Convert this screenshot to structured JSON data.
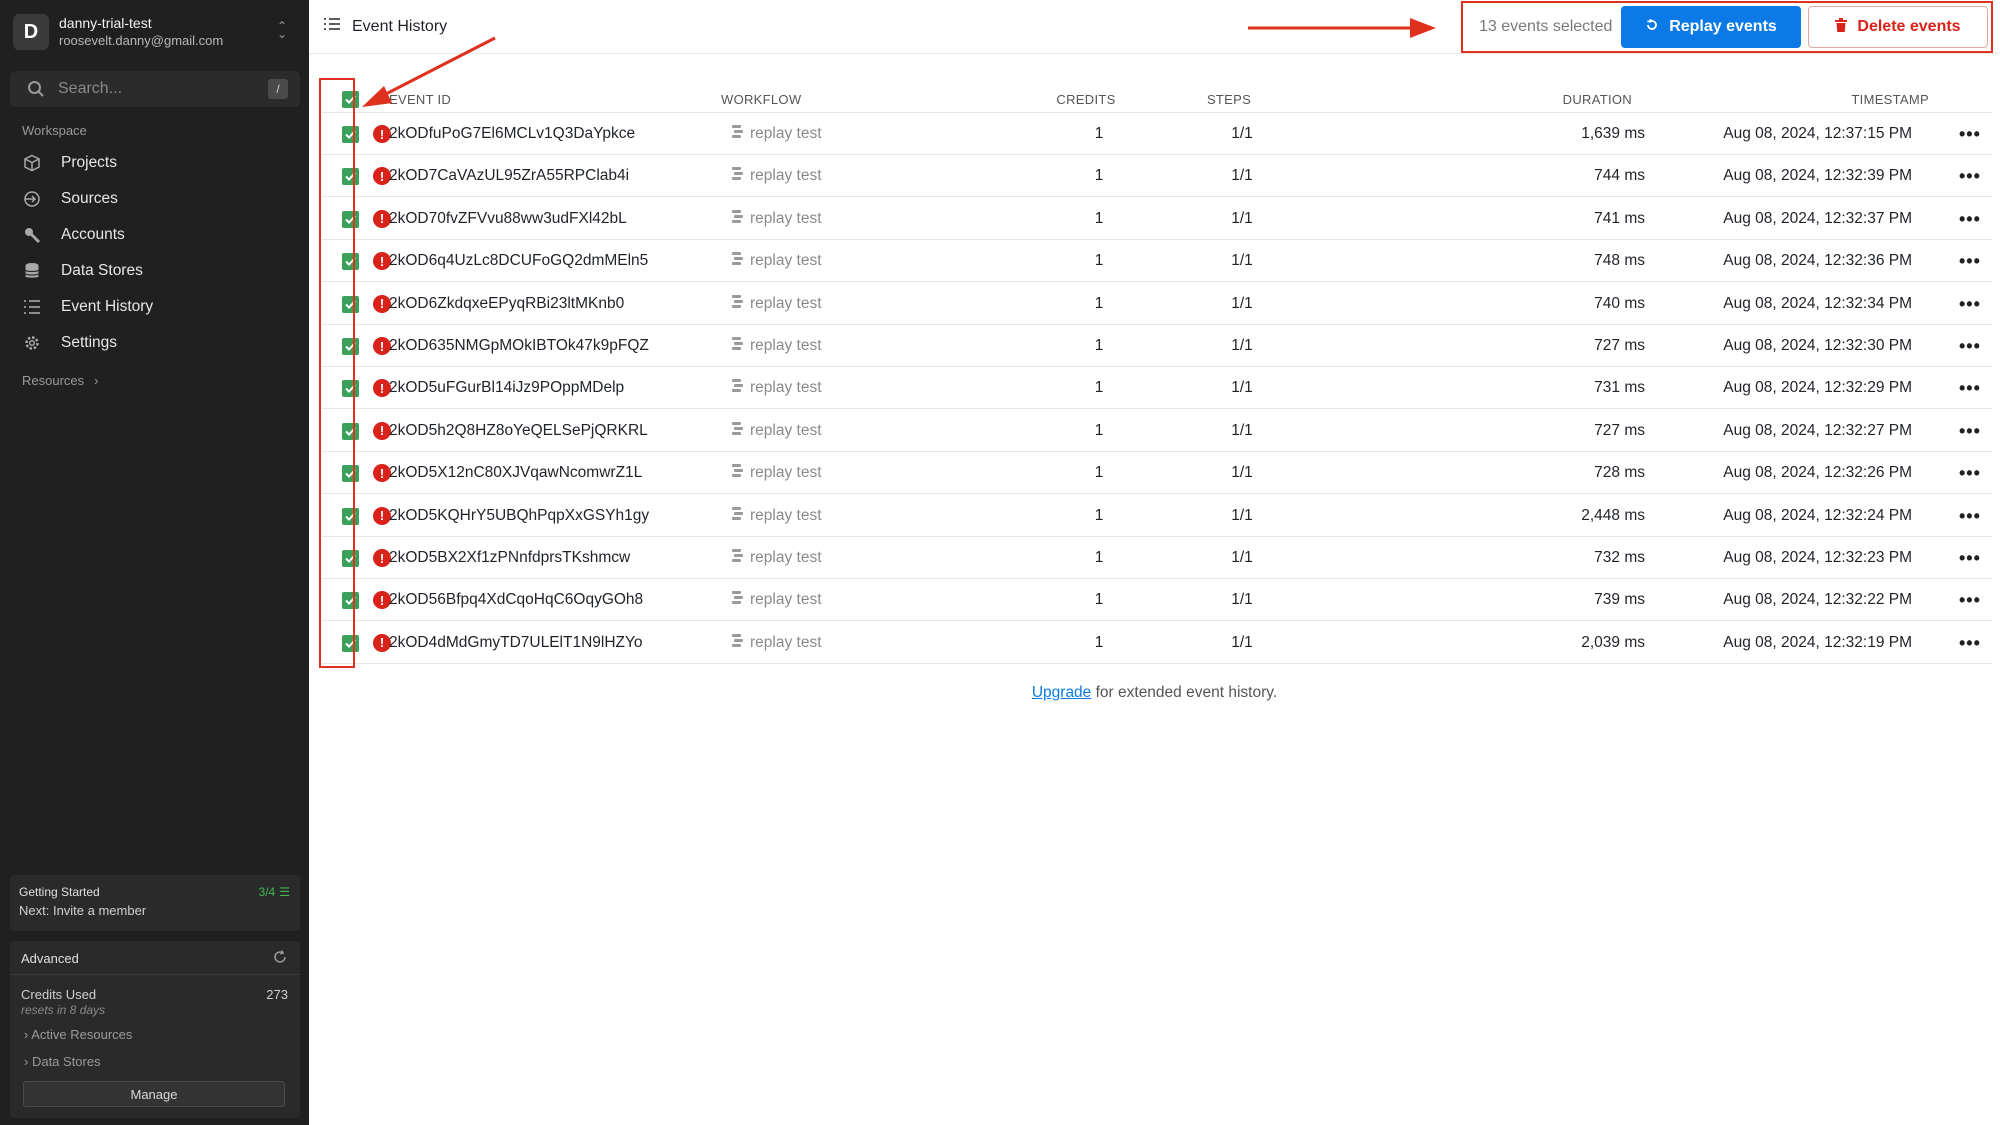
{
  "account": {
    "initial": "D",
    "name": "danny-trial-test",
    "email": "roosevelt.danny@gmail.com"
  },
  "search": {
    "placeholder": "Search...",
    "shortcut": "/"
  },
  "sidebar": {
    "section_label": "Workspace",
    "items": [
      {
        "label": "Projects",
        "icon": "cube-icon"
      },
      {
        "label": "Sources",
        "icon": "source-icon"
      },
      {
        "label": "Accounts",
        "icon": "wrench-icon"
      },
      {
        "label": "Data Stores",
        "icon": "database-icon"
      },
      {
        "label": "Event History",
        "icon": "list-icon"
      },
      {
        "label": "Settings",
        "icon": "gear-icon"
      }
    ],
    "resources_label": "Resources"
  },
  "getting_started": {
    "title": "Getting Started",
    "progress": "3/4",
    "next": "Next: Invite a member"
  },
  "advanced": {
    "title": "Advanced",
    "credits_label": "Credits Used",
    "credits_value": "273",
    "credits_reset": "resets in 8 days",
    "active_resources": "Active Resources",
    "data_stores": "Data Stores",
    "manage_label": "Manage"
  },
  "header": {
    "title": "Event History",
    "selected_text": "13 events selected",
    "replay_label": "Replay events",
    "delete_label": "Delete events"
  },
  "table": {
    "columns": [
      "EVENT ID",
      "WORKFLOW",
      "CREDITS",
      "STEPS",
      "DURATION",
      "TIMESTAMP"
    ],
    "rows": [
      {
        "id": "2kODfuPoG7El6MCLv1Q3DaYpkce",
        "workflow": "replay test",
        "credits": "1",
        "steps": "1/1",
        "duration": "1,639 ms",
        "timestamp": "Aug 08, 2024, 12:37:15 PM"
      },
      {
        "id": "2kOD7CaVAzUL95ZrA55RPClab4i",
        "workflow": "replay test",
        "credits": "1",
        "steps": "1/1",
        "duration": "744 ms",
        "timestamp": "Aug 08, 2024, 12:32:39 PM"
      },
      {
        "id": "2kOD70fvZFVvu88ww3udFXl42bL",
        "workflow": "replay test",
        "credits": "1",
        "steps": "1/1",
        "duration": "741 ms",
        "timestamp": "Aug 08, 2024, 12:32:37 PM"
      },
      {
        "id": "2kOD6q4UzLc8DCUFoGQ2dmMEln5",
        "workflow": "replay test",
        "credits": "1",
        "steps": "1/1",
        "duration": "748 ms",
        "timestamp": "Aug 08, 2024, 12:32:36 PM"
      },
      {
        "id": "2kOD6ZkdqxeEPyqRBi23ltMKnb0",
        "workflow": "replay test",
        "credits": "1",
        "steps": "1/1",
        "duration": "740 ms",
        "timestamp": "Aug 08, 2024, 12:32:34 PM"
      },
      {
        "id": "2kOD635NMGpMOkIBTOk47k9pFQZ",
        "workflow": "replay test",
        "credits": "1",
        "steps": "1/1",
        "duration": "727 ms",
        "timestamp": "Aug 08, 2024, 12:32:30 PM"
      },
      {
        "id": "2kOD5uFGurBl14iJz9POppMDelp",
        "workflow": "replay test",
        "credits": "1",
        "steps": "1/1",
        "duration": "731 ms",
        "timestamp": "Aug 08, 2024, 12:32:29 PM"
      },
      {
        "id": "2kOD5h2Q8HZ8oYeQELSePjQRKRL",
        "workflow": "replay test",
        "credits": "1",
        "steps": "1/1",
        "duration": "727 ms",
        "timestamp": "Aug 08, 2024, 12:32:27 PM"
      },
      {
        "id": "2kOD5X12nC80XJVqawNcomwrZ1L",
        "workflow": "replay test",
        "credits": "1",
        "steps": "1/1",
        "duration": "728 ms",
        "timestamp": "Aug 08, 2024, 12:32:26 PM"
      },
      {
        "id": "2kOD5KQHrY5UBQhPqpXxGSYh1gy",
        "workflow": "replay test",
        "credits": "1",
        "steps": "1/1",
        "duration": "2,448 ms",
        "timestamp": "Aug 08, 2024, 12:32:24 PM"
      },
      {
        "id": "2kOD5BX2Xf1zPNnfdprsTKshmcw",
        "workflow": "replay test",
        "credits": "1",
        "steps": "1/1",
        "duration": "732 ms",
        "timestamp": "Aug 08, 2024, 12:32:23 PM"
      },
      {
        "id": "2kOD56Bfpq4XdCqoHqC6OqyGOh8",
        "workflow": "replay test",
        "credits": "1",
        "steps": "1/1",
        "duration": "739 ms",
        "timestamp": "Aug 08, 2024, 12:32:22 PM"
      },
      {
        "id": "2kOD4dMdGmyTD7ULElT1N9lHZYo",
        "workflow": "replay test",
        "credits": "1",
        "steps": "1/1",
        "duration": "2,039 ms",
        "timestamp": "Aug 08, 2024, 12:32:19 PM"
      }
    ]
  },
  "footer": {
    "link_label": "Upgrade",
    "text": " for extended event history."
  },
  "colors": {
    "accent": "#0b7ae6",
    "danger": "#d9231a",
    "check": "#3aa05a",
    "annotation": "#e0301e",
    "sidebar_bg": "#202020"
  }
}
